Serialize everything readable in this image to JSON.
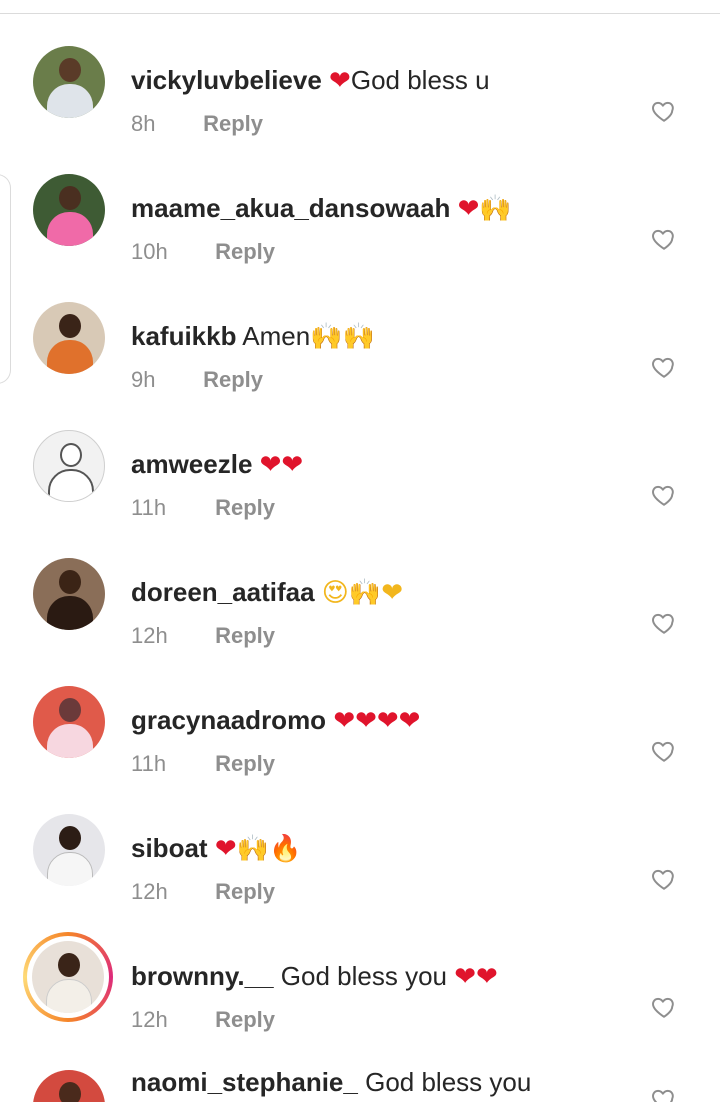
{
  "icons": {
    "like": "heart-outline-icon"
  },
  "colors": {
    "username": "#262626",
    "meta": "#8e8e8e",
    "divider": "#dbdbdb",
    "story_ring": "#dd2a7b"
  },
  "comments": [
    {
      "username": "vickyluvbelieve",
      "emoji_before": "❤",
      "text": "God bless u",
      "emoji_after": "",
      "time": "8h",
      "reply": "Reply"
    },
    {
      "username": "maame_akua_dansowaah",
      "emoji_before": "",
      "text": "",
      "emoji_after": "❤🙌",
      "time": "10h",
      "reply": "Reply"
    },
    {
      "username": "kafuikkb",
      "emoji_before": "",
      "text": "Amen",
      "emoji_after": "🙌🙌",
      "time": "9h",
      "reply": "Reply"
    },
    {
      "username": "amweezle",
      "emoji_before": "",
      "text": "",
      "emoji_after": "❤❤",
      "time": "11h",
      "reply": "Reply"
    },
    {
      "username": "doreen_aatifaa",
      "emoji_before": "",
      "text": "",
      "emoji_after": "😍🙌❤",
      "time": "12h",
      "reply": "Reply"
    },
    {
      "username": "gracynaadromo",
      "emoji_before": "",
      "text": "",
      "emoji_after": "❤❤❤❤",
      "time": "11h",
      "reply": "Reply"
    },
    {
      "username": "siboat",
      "emoji_before": "",
      "text": "",
      "emoji_after": "❤🙌🔥",
      "time": "12h",
      "reply": "Reply"
    },
    {
      "username": "brownny.__",
      "emoji_before": "",
      "text": "God bless you",
      "emoji_after": "❤❤",
      "time": "12h",
      "reply": "Reply"
    },
    {
      "username": "naomi_stephanie_",
      "emoji_before": "",
      "text": "God bless you",
      "emoji_after": "",
      "time": "",
      "reply": ""
    }
  ]
}
